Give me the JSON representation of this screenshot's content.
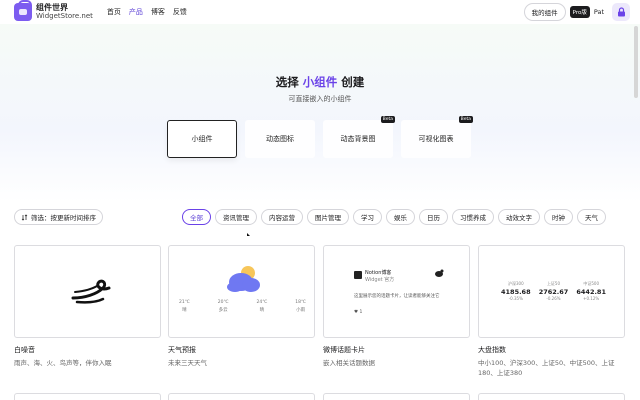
{
  "header": {
    "logo_cn": "组件世界",
    "logo_en": "WidgetStore.net",
    "nav": [
      "首页",
      "产品",
      "博客",
      "反馈"
    ],
    "nav_active": 1,
    "my_widgets": "我的组件",
    "pro_badge": "Pro版",
    "user": "Pat"
  },
  "hero": {
    "title_prefix": "选择",
    "title_accent": "小组件",
    "title_suffix": "创建",
    "subtitle": "可直接嵌入的小组件",
    "types": [
      {
        "label": "小组件",
        "selected": true,
        "beta": ""
      },
      {
        "label": "动态图标",
        "selected": false,
        "beta": ""
      },
      {
        "label": "动态背景图",
        "selected": false,
        "beta": "Beta"
      },
      {
        "label": "可视化图表",
        "selected": false,
        "beta": "Beta"
      }
    ]
  },
  "filter": {
    "sort_label": "筛选：按更新时间排序",
    "categories": [
      "全部",
      "资讯管理",
      "内容运营",
      "图片管理",
      "学习",
      "娱乐",
      "日历",
      "习惯养成",
      "动效文字",
      "时钟",
      "天气"
    ],
    "active_category": 0
  },
  "cards": [
    {
      "title": "白噪音",
      "desc": "雨声、海、火、鸟声等，伴你入眠",
      "icon": "wind-icon"
    },
    {
      "title": "天气预报",
      "desc": "未来三天天气",
      "icon": "cloud-icon",
      "forecast": [
        {
          "temp": "21℃",
          "desc": "晴"
        },
        {
          "temp": "20℃",
          "desc": "多云"
        },
        {
          "temp": "24℃",
          "desc": "晴"
        },
        {
          "temp": "18℃",
          "desc": "小雨"
        }
      ]
    },
    {
      "title": "微博话题卡片",
      "desc": "嵌入相关话题数据",
      "icon": "social-icon",
      "preview_name": "Notion博客",
      "preview_sub": "Widget 官方",
      "preview_text": "这里展示您的话题卡片，让读者能够关注它",
      "preview_count": "1"
    },
    {
      "title": "大盘指数",
      "desc": "中小100、沪深300、上证50、中证500、上证180、上证380",
      "icon": "chart-icon",
      "stats": [
        {
          "label": "沪深300",
          "value": "4185.68",
          "change": "-0.35%"
        },
        {
          "label": "上证50",
          "value": "2762.67",
          "change": "-0.26%"
        },
        {
          "label": "中证500",
          "value": "6442.81",
          "change": "+0.12%"
        }
      ]
    }
  ],
  "colors": {
    "accent": "#6a42e8",
    "dark": "#1c1c1e",
    "border": "#dcdce0"
  }
}
